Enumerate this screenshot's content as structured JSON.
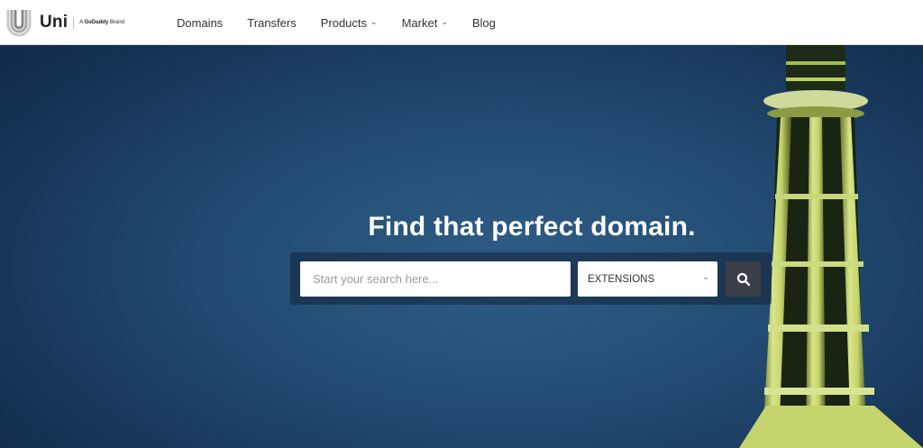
{
  "header": {
    "logo": {
      "name": "Uni",
      "brand_prefix": "A",
      "brand_name": "GoDaddy",
      "brand_suffix": "Brand"
    },
    "nav": [
      {
        "label": "Domains",
        "has_dropdown": false
      },
      {
        "label": "Transfers",
        "has_dropdown": false
      },
      {
        "label": "Products",
        "has_dropdown": true
      },
      {
        "label": "Market",
        "has_dropdown": true
      },
      {
        "label": "Blog",
        "has_dropdown": false
      }
    ]
  },
  "hero": {
    "title": "Find that perfect domain.",
    "search": {
      "placeholder": "Start your search here...",
      "value": ""
    },
    "extensions": {
      "selected": "EXTENSIONS"
    },
    "search_button_icon": "search-icon"
  },
  "icons": {
    "dropdown": "chevron-down-icon",
    "search": "search-icon",
    "logo": "uni-logo-icon"
  },
  "colors": {
    "header_bg": "#ffffff",
    "hero_bg": "#234b72",
    "search_button": "#3a3f47",
    "title_text": "#ffffff"
  }
}
